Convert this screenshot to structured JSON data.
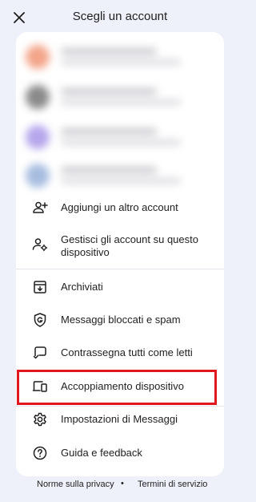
{
  "header": {
    "title": "Scegli un account",
    "close_icon": "close-icon"
  },
  "accounts": {
    "note_blurred": true,
    "items": [
      {
        "avatar_color": "#f4a58a"
      },
      {
        "avatar_color": "#8a8a8a"
      },
      {
        "avatar_color": "#b6a6ec"
      },
      {
        "avatar_color": "#a7bde0"
      }
    ]
  },
  "menu": {
    "add_account": "Aggiungi un altro account",
    "manage_accounts": "Gestisci gli account su questo dispositivo",
    "archived": "Archiviati",
    "blocked_spam": "Messaggi bloccati e spam",
    "mark_all_read": "Contrassegna tutti come letti",
    "device_pairing": "Accoppiamento dispositivo",
    "settings": "Impostazioni di Messaggi",
    "help_feedback": "Guida e feedback"
  },
  "footer": {
    "privacy": "Norme sulla privacy",
    "separator": "•",
    "terms": "Termini di servizio"
  },
  "colors": {
    "background": "#eef0fa",
    "card": "#ffffff",
    "highlight_border": "#e0171f",
    "text": "#1f1f1f"
  }
}
